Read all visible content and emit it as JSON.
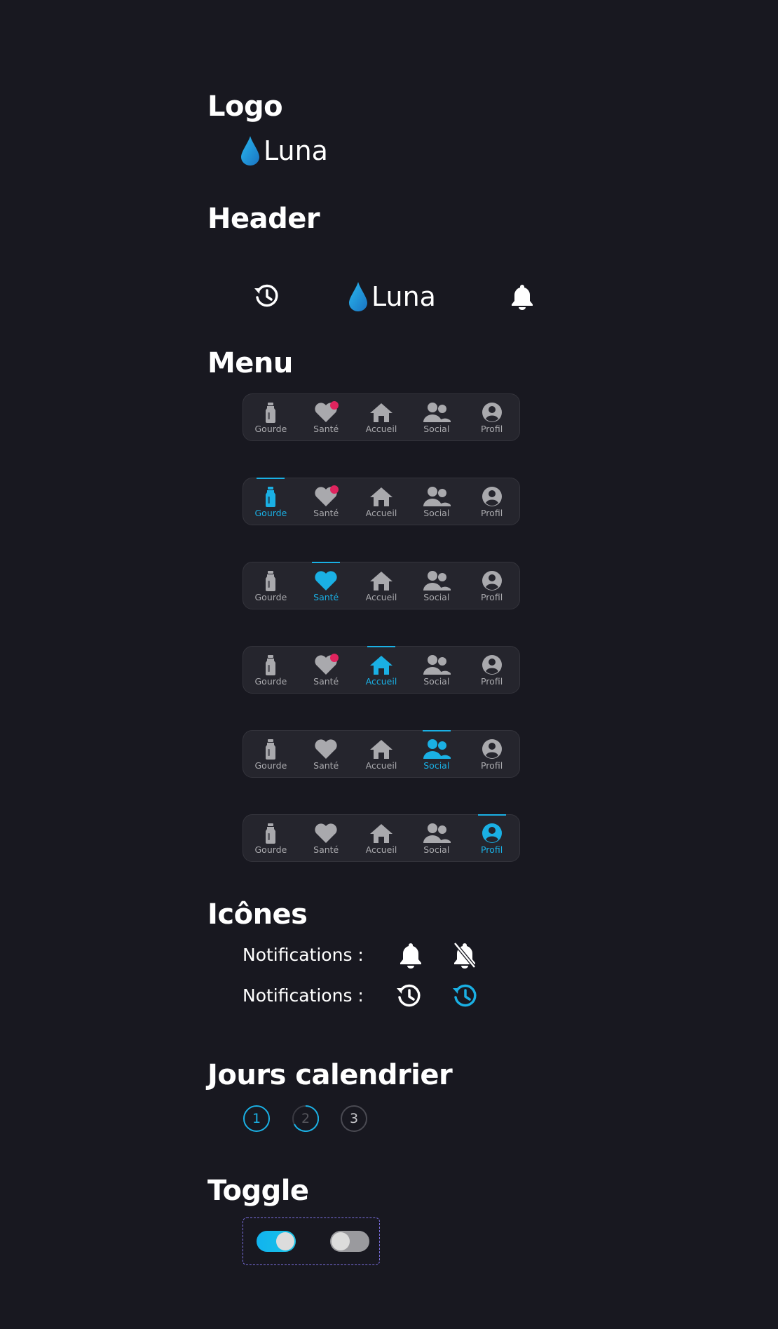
{
  "sections": {
    "logo": "Logo",
    "header": "Header",
    "menu": "Menu",
    "icons": "Icônes",
    "calendar": "Jours calendrier",
    "toggle": "Toggle"
  },
  "brand": {
    "name": "Luna"
  },
  "nav_labels": {
    "gourde": "Gourde",
    "sante": "Santé",
    "accueil": "Accueil",
    "social": "Social",
    "profil": "Profil"
  },
  "nav_variants": [
    {
      "active": "none",
      "sante_badge": true
    },
    {
      "active": "gourde",
      "sante_badge": true
    },
    {
      "active": "sante",
      "sante_badge": false
    },
    {
      "active": "accueil",
      "sante_badge": true
    },
    {
      "active": "social",
      "sante_badge": false
    },
    {
      "active": "profil",
      "sante_badge": false
    }
  ],
  "icon_rows": [
    {
      "label": "Notifications :",
      "icons": [
        "bell-icon",
        "bell-off-icon"
      ]
    },
    {
      "label": "Notifications :",
      "icons": [
        "history-icon",
        "history-active-icon"
      ]
    }
  ],
  "calendar_days": [
    "1",
    "2",
    "3"
  ],
  "toggles": [
    {
      "state": "on"
    },
    {
      "state": "off"
    }
  ],
  "colors": {
    "background": "#181820",
    "accent": "#1ab0e4",
    "inactive": "#a9a9ad",
    "badge": "#e0245e",
    "nav_bg": "#25252d",
    "dashed_border": "#7b6fe0"
  }
}
